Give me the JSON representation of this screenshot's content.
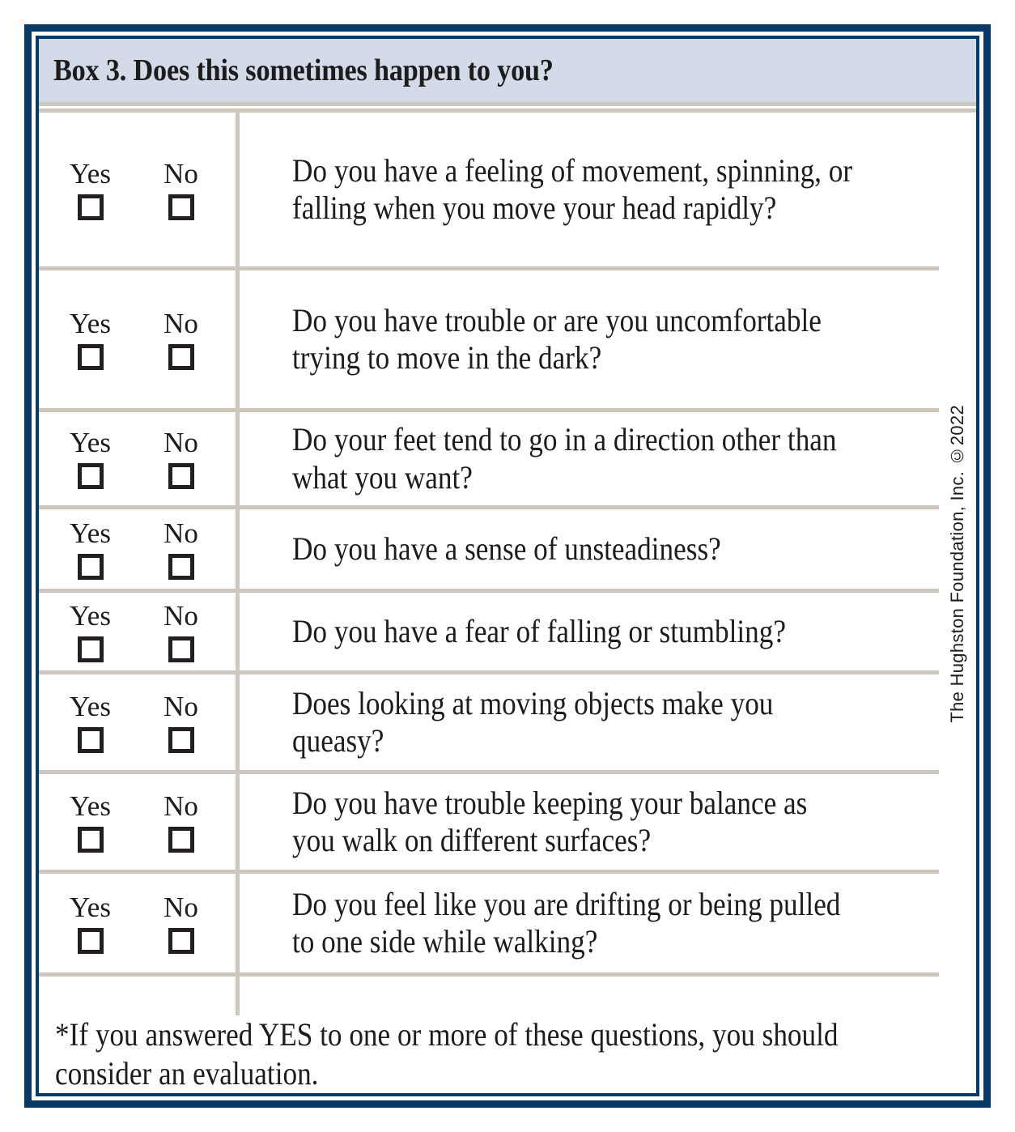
{
  "box": {
    "title": "Box 3. Does this sometimes happen to you?",
    "copyright": "The Hughston Foundation, Inc. ©2022",
    "footnote": "*If you answered YES to one or more of these questions, you should consider an evaluation.",
    "answer_labels": {
      "yes": "Yes",
      "no": "No"
    },
    "colors": {
      "border_navy": "#073a66",
      "header_fill": "#d3dae8",
      "rule_gray": "#cdc7be",
      "text": "#1c1c1c",
      "checkbox_border": "#231f20"
    },
    "questions": [
      {
        "id": 1,
        "text": "Do you have a feeling of movement, spinning, or falling when you move your head rapidly?",
        "yes_label": "Yes",
        "no_label": "No",
        "yes_checked": false,
        "no_checked": false
      },
      {
        "id": 2,
        "text": "Do you have trouble or are you uncomfortable trying to move in the dark?",
        "yes_label": "Yes",
        "no_label": "No",
        "yes_checked": false,
        "no_checked": false
      },
      {
        "id": 3,
        "text": "Do your feet tend to go in a direction other than what you want?",
        "yes_label": "Yes",
        "no_label": "No",
        "yes_checked": false,
        "no_checked": false
      },
      {
        "id": 4,
        "text": "Do you have a sense of unsteadiness?",
        "yes_label": "Yes",
        "no_label": "No",
        "yes_checked": false,
        "no_checked": false
      },
      {
        "id": 5,
        "text": "Do you have a fear of falling or stumbling?",
        "yes_label": "Yes",
        "no_label": "No",
        "yes_checked": false,
        "no_checked": false
      },
      {
        "id": 6,
        "text": "Does looking at moving objects make you queasy?",
        "yes_label": "Yes",
        "no_label": "No",
        "yes_checked": false,
        "no_checked": false
      },
      {
        "id": 7,
        "text": "Do you have trouble keeping your balance as you walk on different surfaces?",
        "yes_label": "Yes",
        "no_label": "No",
        "yes_checked": false,
        "no_checked": false
      },
      {
        "id": 8,
        "text": "Do you feel like you are drifting or being pulled to one side while walking?",
        "yes_label": "Yes",
        "no_label": "No",
        "yes_checked": false,
        "no_checked": false
      }
    ]
  }
}
